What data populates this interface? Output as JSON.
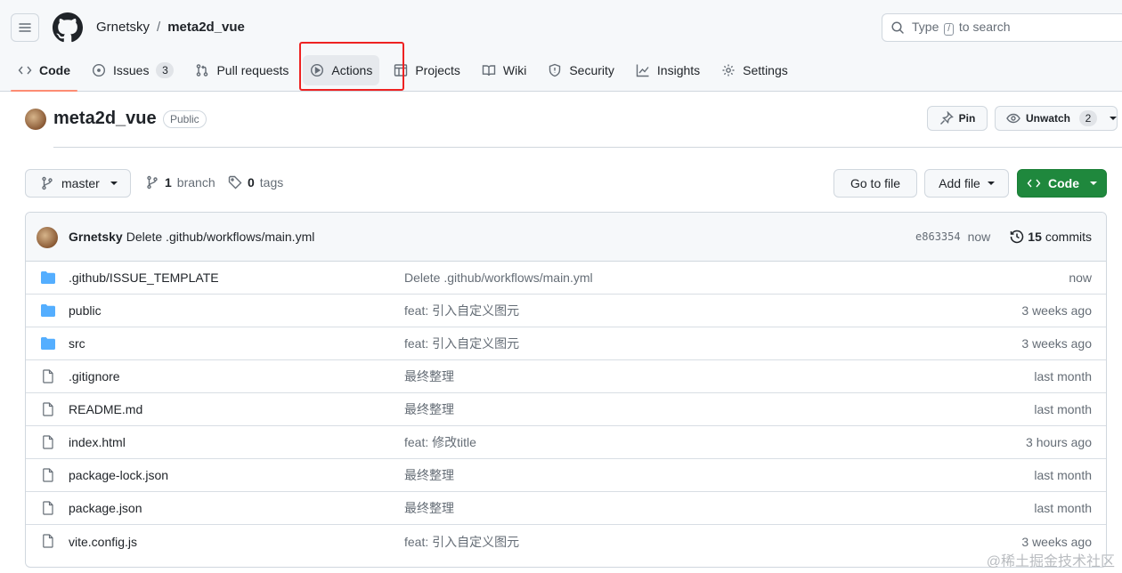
{
  "header": {
    "owner": "Grnetsky",
    "separator": "/",
    "repo": "meta2d_vue",
    "search": {
      "prefix": "Type",
      "key": "/",
      "suffix": "to search"
    }
  },
  "tabs": [
    {
      "label": "Code",
      "icon": "code-icon"
    },
    {
      "label": "Issues",
      "icon": "issue-icon",
      "count": "3"
    },
    {
      "label": "Pull requests",
      "icon": "pull-request-icon"
    },
    {
      "label": "Actions",
      "icon": "play-icon"
    },
    {
      "label": "Projects",
      "icon": "table-icon"
    },
    {
      "label": "Wiki",
      "icon": "book-icon"
    },
    {
      "label": "Security",
      "icon": "shield-icon"
    },
    {
      "label": "Insights",
      "icon": "graph-icon"
    },
    {
      "label": "Settings",
      "icon": "gear-icon"
    }
  ],
  "repo_header": {
    "name": "meta2d_vue",
    "visibility": "Public",
    "pin_label": "Pin",
    "watch_label": "Unwatch",
    "watch_count": "2"
  },
  "toolbar": {
    "branch": "master",
    "branch_count": "1",
    "branch_word": "branch",
    "tag_count": "0",
    "tag_word": "tags",
    "go_to_file": "Go to file",
    "add_file": "Add file",
    "code": "Code"
  },
  "latest_commit": {
    "author": "Grnetsky",
    "message": "Delete .github/workflows/main.yml",
    "sha": "e863354",
    "time": "now",
    "commit_count": "15",
    "commit_word": "commits"
  },
  "files": [
    {
      "type": "dir",
      "name": ".github/ISSUE_TEMPLATE",
      "message": "Delete .github/workflows/main.yml",
      "age": "now"
    },
    {
      "type": "dir",
      "name": "public",
      "message": "feat: 引入自定义图元",
      "age": "3 weeks ago"
    },
    {
      "type": "dir",
      "name": "src",
      "message": "feat: 引入自定义图元",
      "age": "3 weeks ago"
    },
    {
      "type": "file",
      "name": ".gitignore",
      "message": "最终整理",
      "age": "last month"
    },
    {
      "type": "file",
      "name": "README.md",
      "message": "最终整理",
      "age": "last month"
    },
    {
      "type": "file",
      "name": "index.html",
      "message": "feat: 修改title",
      "age": "3 hours ago"
    },
    {
      "type": "file",
      "name": "package-lock.json",
      "message": "最终整理",
      "age": "last month"
    },
    {
      "type": "file",
      "name": "package.json",
      "message": "最终整理",
      "age": "last month"
    },
    {
      "type": "file",
      "name": "vite.config.js",
      "message": "feat: 引入自定义图元",
      "age": "3 weeks ago"
    }
  ],
  "watermark": "@稀土掘金技术社区",
  "colors": {
    "accent": "#fd8c73",
    "green": "#1f883d",
    "folder": "#54aeff",
    "highlight": "#e22222"
  }
}
